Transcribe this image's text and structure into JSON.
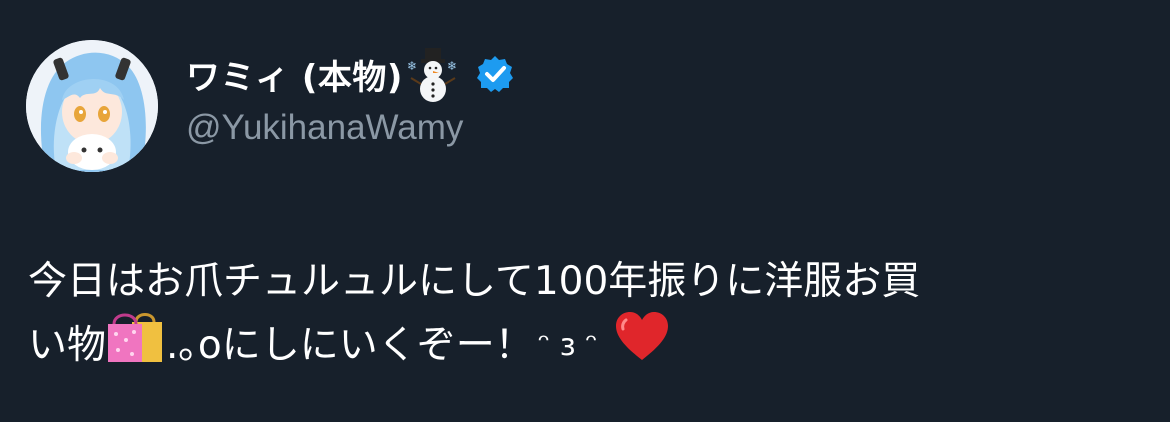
{
  "author": {
    "display_name": "ワミィ (本物)",
    "handle": "@YukihanaWamy",
    "name_emoji": "snowman-icon",
    "verified": true,
    "verified_color": "#1d9bf0"
  },
  "tweet": {
    "line1": "今日はお爪チュルュルにして100年振りに洋服お買",
    "line2_start": "い物",
    "line2_mid": ".｡oにしにいくぞー！",
    "line2_face": "ᵔ ɜ ᵔ",
    "line2_emoji_1": "shopping-bags-icon",
    "line2_emoji_2": "red-heart-icon"
  },
  "colors": {
    "background": "#17202b",
    "text": "#ffffff",
    "secondary_text": "#8b98a5"
  }
}
